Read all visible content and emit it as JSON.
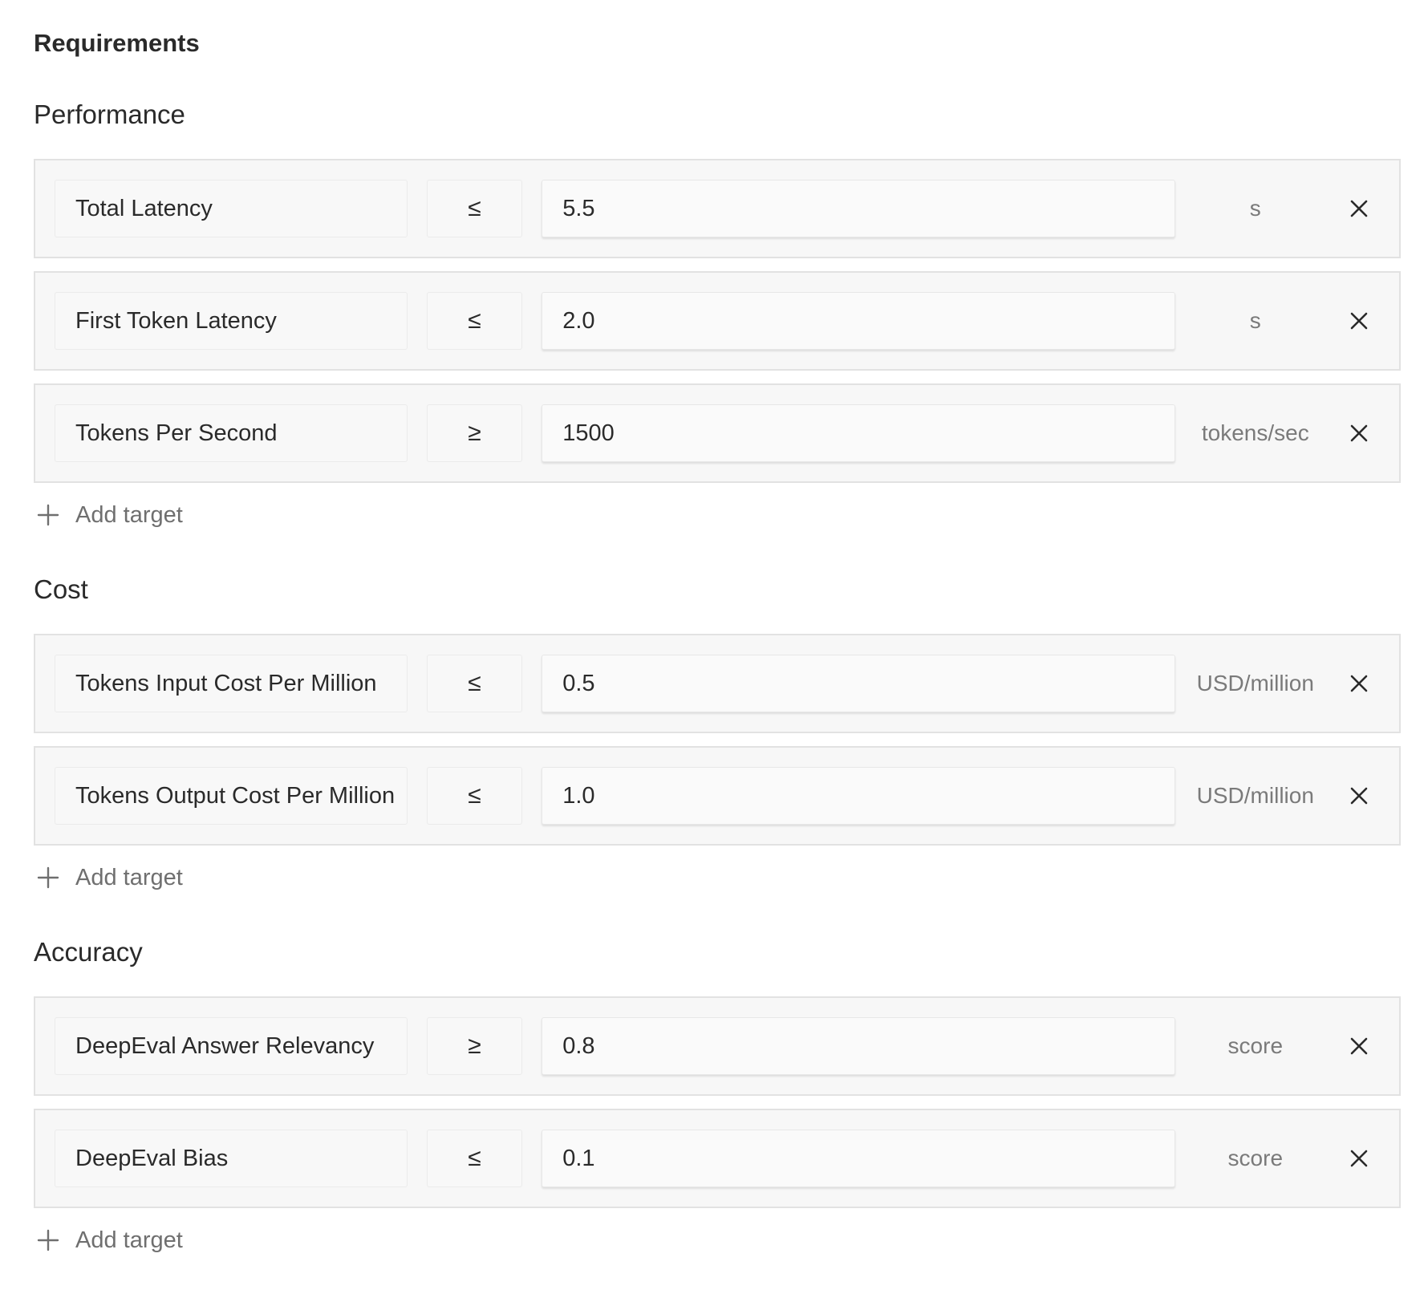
{
  "page": {
    "title": "Requirements"
  },
  "sections": [
    {
      "title": "Performance",
      "add_label": "Add target",
      "rows": [
        {
          "metric": "Total Latency",
          "operator": "≤",
          "value": "5.5",
          "unit": "s"
        },
        {
          "metric": "First Token Latency",
          "operator": "≤",
          "value": "2.0",
          "unit": "s"
        },
        {
          "metric": "Tokens Per Second",
          "operator": "≥",
          "value": "1500",
          "unit": "tokens/sec"
        }
      ]
    },
    {
      "title": "Cost",
      "add_label": "Add target",
      "rows": [
        {
          "metric": "Tokens Input Cost Per Million",
          "operator": "≤",
          "value": "0.5",
          "unit": "USD/million"
        },
        {
          "metric": "Tokens Output Cost Per Million",
          "operator": "≤",
          "value": "1.0",
          "unit": "USD/million"
        }
      ]
    },
    {
      "title": "Accuracy",
      "add_label": "Add target",
      "rows": [
        {
          "metric": "DeepEval Answer Relevancy",
          "operator": "≥",
          "value": "0.8",
          "unit": "score"
        },
        {
          "metric": "DeepEval Bias",
          "operator": "≤",
          "value": "0.1",
          "unit": "score"
        }
      ]
    }
  ],
  "icons": {
    "remove": "close-icon",
    "add": "plus-icon"
  },
  "colors": {
    "row_bg": "#f7f7f7",
    "row_border": "#e2e2e2",
    "muted_text": "#7a7a7a"
  }
}
